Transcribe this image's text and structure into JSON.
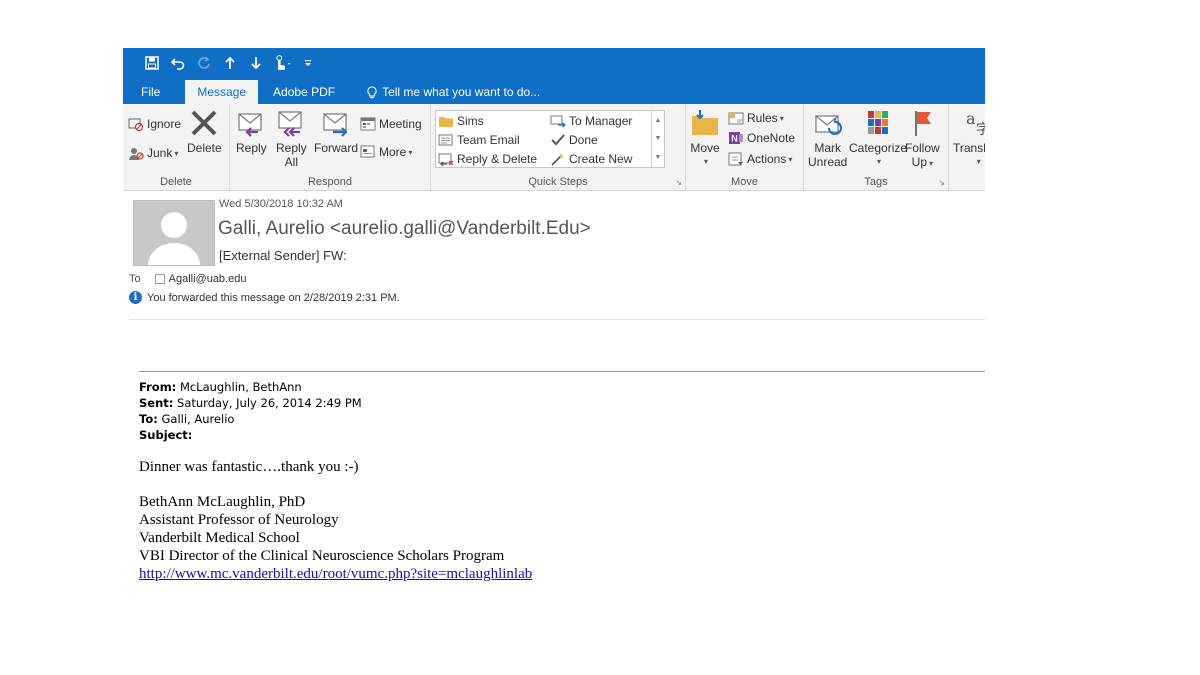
{
  "colors": {
    "accent": "#0f6fc6",
    "ribbon_bg": "#f3f3f3",
    "link": "#1a0dab",
    "info": "#1e6fc2"
  },
  "qat": {
    "icons": [
      "save-icon",
      "undo-icon",
      "redo-icon",
      "up-icon",
      "down-icon",
      "touch-mode-icon",
      "customize-icon"
    ]
  },
  "tabs": {
    "file": "File",
    "message": "Message",
    "adobe_pdf": "Adobe PDF",
    "tell_me": "Tell me what you want to do..."
  },
  "ribbon": {
    "delete_group": {
      "label": "Delete",
      "ignore": "Ignore",
      "junk": "Junk",
      "delete": "Delete"
    },
    "respond_group": {
      "label": "Respond",
      "reply": "Reply",
      "reply_all_1": "Reply",
      "reply_all_2": "All",
      "forward": "Forward",
      "meeting": "Meeting",
      "more": "More"
    },
    "quick_steps_group": {
      "label": "Quick Steps",
      "items": [
        "Sims",
        "To Manager",
        "Team Email",
        "Done",
        "Reply & Delete",
        "Create New"
      ]
    },
    "move_group": {
      "label": "Move",
      "move": "Move",
      "rules": "Rules",
      "onenote": "OneNote",
      "actions": "Actions"
    },
    "tags_group": {
      "label": "Tags",
      "mark_unread_1": "Mark",
      "mark_unread_2": "Unread",
      "categorize": "Categorize",
      "follow_up_1": "Follow",
      "follow_up_2": "Up"
    },
    "translate": {
      "label": "Translate"
    }
  },
  "message": {
    "date": "Wed 5/30/2018 10:32 AM",
    "sender": "Galli, Aurelio <aurelio.galli@Vanderbilt.Edu>",
    "subject": "[External Sender] FW:",
    "to_label": "To",
    "to_value": "Agalli@uab.edu",
    "info": "You forwarded this message on 2/28/2019 2:31 PM."
  },
  "forwarded": {
    "from_label": "From:",
    "from_value": "McLaughlin, BethAnn",
    "sent_label": "Sent:",
    "sent_value": "Saturday, July 26, 2014 2:49 PM",
    "to_label": "To:",
    "to_value": "Galli, Aurelio",
    "subject_label": "Subject:",
    "subject_value": ""
  },
  "body": {
    "text": "Dinner was fantastic….thank you :-)",
    "signature": [
      "BethAnn McLaughlin, PhD",
      "Assistant Professor of Neurology",
      "Vanderbilt Medical School",
      "VBI Director of the Clinical Neuroscience Scholars Program"
    ],
    "link": "http://www.mc.vanderbilt.edu/root/vumc.php?site=mclaughlinlab"
  }
}
